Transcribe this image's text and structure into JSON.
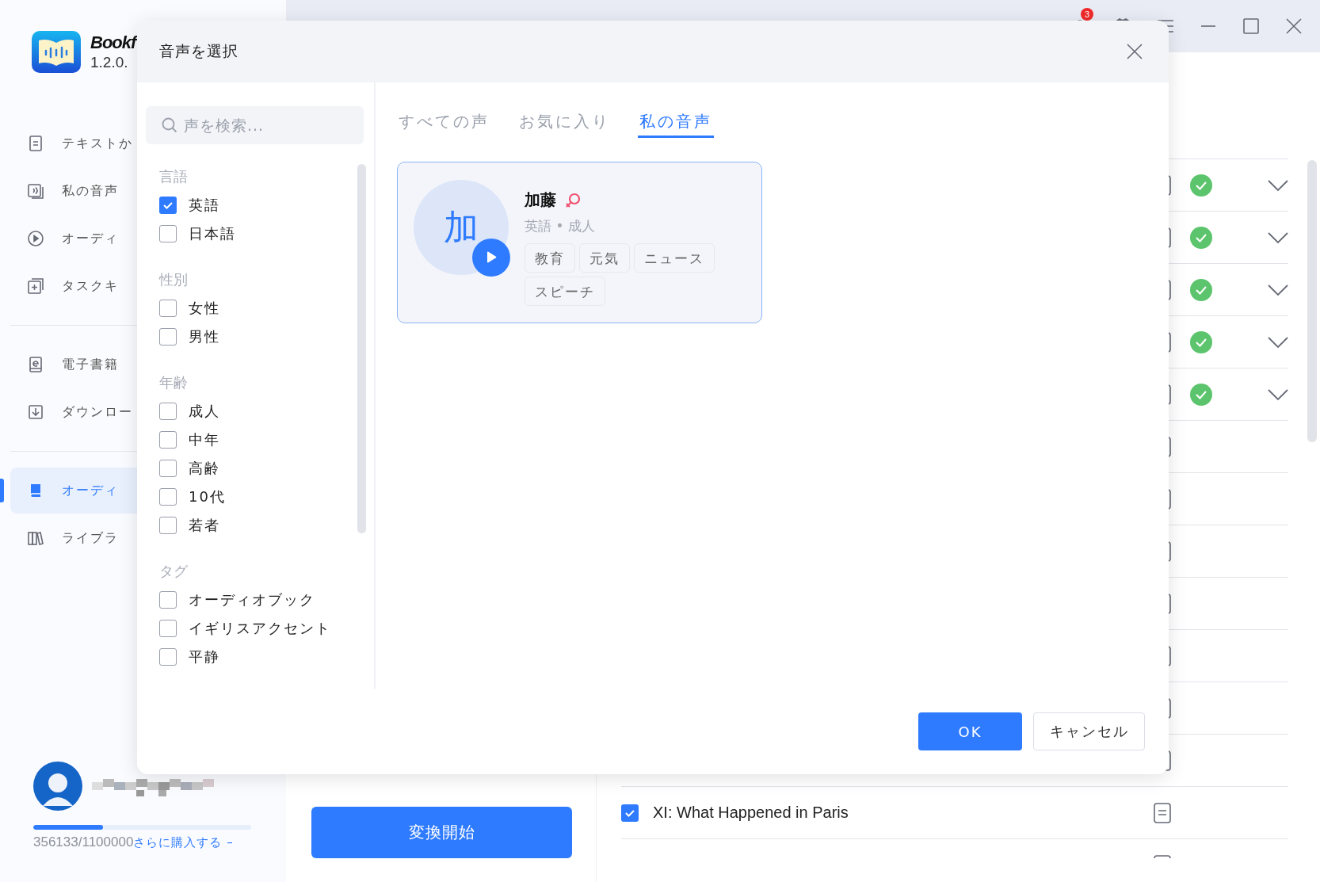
{
  "app": {
    "name": "Bookf",
    "version": "1.2.0."
  },
  "titlebar": {
    "notification_count": "3"
  },
  "sidebar": {
    "groups": [
      {
        "items": [
          {
            "label": "テキストか",
            "selected": false
          },
          {
            "label": "私の音声",
            "selected": false
          },
          {
            "label": "オーディ",
            "selected": false
          },
          {
            "label": "タスクキ",
            "selected": false
          }
        ]
      },
      {
        "items": [
          {
            "label": "電子書籍",
            "selected": false
          },
          {
            "label": "ダウンロー",
            "selected": false
          }
        ]
      },
      {
        "items": [
          {
            "label": "オーディ",
            "selected": true
          },
          {
            "label": "ライブラ",
            "selected": false
          }
        ]
      }
    ]
  },
  "account": {
    "usage": "356133/1100000",
    "level": 0.32,
    "buy_link": "さらに購入する –"
  },
  "convert_button": "変換開始",
  "chapters": [
    {
      "done": true
    },
    {
      "done": true
    },
    {
      "done": true
    },
    {
      "done": true
    },
    {
      "done": true
    },
    {
      "done": false
    },
    {
      "done": false
    },
    {
      "done": false
    },
    {
      "done": false
    },
    {
      "done": false
    },
    {
      "done": false
    },
    {
      "done": false
    },
    {
      "title": "XI: What Happened in Paris",
      "checked": true,
      "done": false
    },
    {
      "done": false
    }
  ],
  "dialog": {
    "title": "音声を選択",
    "search": {
      "placeholder": "声を検索..."
    },
    "filters": [
      {
        "label": "言語",
        "options": [
          {
            "label": "英語",
            "checked": true
          },
          {
            "label": "日本語",
            "checked": false
          }
        ]
      },
      {
        "label": "性別",
        "options": [
          {
            "label": "女性",
            "checked": false
          },
          {
            "label": "男性",
            "checked": false
          }
        ]
      },
      {
        "label": "年齢",
        "options": [
          {
            "label": "成人",
            "checked": false
          },
          {
            "label": "中年",
            "checked": false
          },
          {
            "label": "高齢",
            "checked": false
          },
          {
            "label": "10代",
            "checked": false
          },
          {
            "label": "若者",
            "checked": false
          }
        ]
      },
      {
        "label": "タグ",
        "options": [
          {
            "label": "オーディオブック",
            "checked": false
          },
          {
            "label": "イギリスアクセント",
            "checked": false
          },
          {
            "label": "平静",
            "checked": false
          }
        ]
      }
    ],
    "tabs": [
      {
        "label": "すべての声",
        "selected": false
      },
      {
        "label": "お気に入り",
        "selected": false
      },
      {
        "label": "私の音声",
        "selected": true
      }
    ],
    "voices": [
      {
        "initial": "加",
        "name": "加藤",
        "kind": "female",
        "meta": "英語 • 成人",
        "tags": [
          "教育",
          "元気",
          "ニュース",
          "スピーチ"
        ]
      }
    ],
    "buttons": [
      {
        "label": "OK",
        "kind": "primary"
      },
      {
        "label": "キャンセル",
        "kind": "secondary"
      }
    ]
  }
}
